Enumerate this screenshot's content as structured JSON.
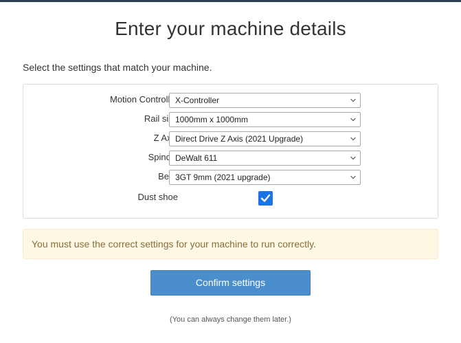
{
  "page": {
    "title": "Enter your machine details",
    "subtitle": "Select the settings that match your machine."
  },
  "form": {
    "fields": [
      {
        "label": "Motion Controller",
        "value": "X-Controller"
      },
      {
        "label": "Rail size",
        "value": "1000mm x 1000mm"
      },
      {
        "label": "Z Axis",
        "value": "Direct Drive Z Axis (2021 Upgrade)"
      },
      {
        "label": "Spindle",
        "value": "DeWalt 611"
      },
      {
        "label": "Belts",
        "value": "3GT 9mm (2021 upgrade)"
      }
    ],
    "dust_shoe": {
      "label": "Dust shoe",
      "checked": true
    }
  },
  "alert": {
    "text": "You must use the correct settings for your machine to run correctly."
  },
  "actions": {
    "confirm_label": "Confirm settings",
    "note": "(You can always change them later.)"
  },
  "colors": {
    "accent": "#4a8fcc",
    "checkbox": "#1a73e8",
    "alert_bg": "#fcf8e3",
    "alert_text": "#8a6d3b"
  },
  "icons": {
    "select_arrow": "chevron-down-icon",
    "checkbox_mark": "checkmark-icon"
  }
}
